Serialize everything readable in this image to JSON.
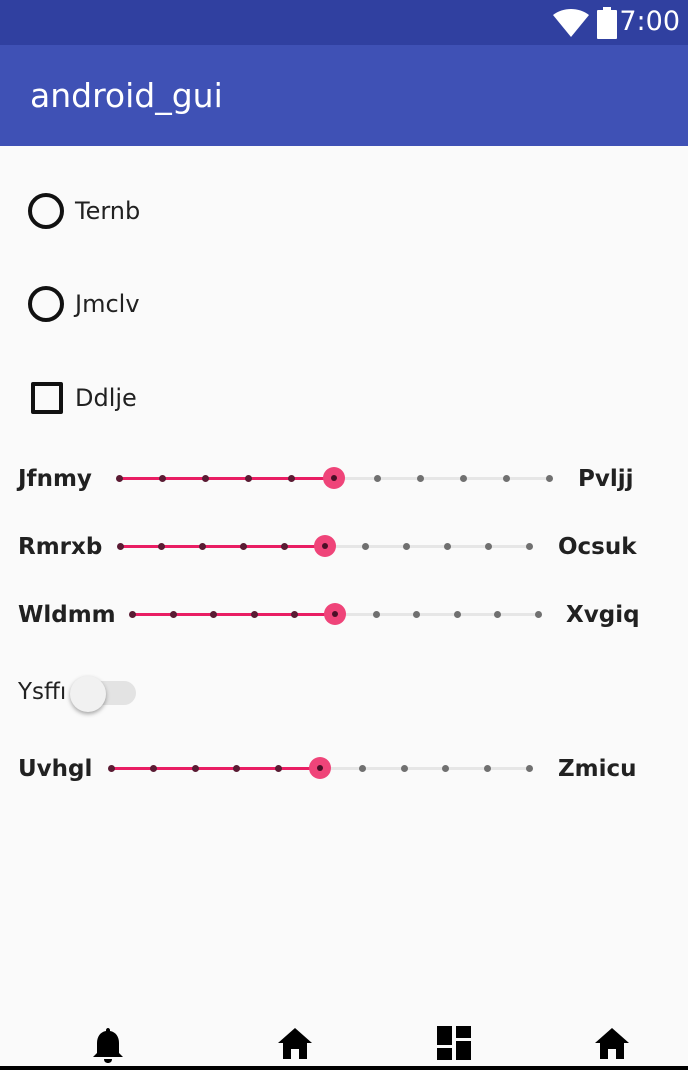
{
  "status_bar": {
    "time": "7:00",
    "icons": [
      "wifi-icon",
      "battery-icon"
    ],
    "color": "#3040a0"
  },
  "app_bar": {
    "title": "android_gui",
    "color": "#3f51b5"
  },
  "options": [
    {
      "type": "radio",
      "label": "Ternb",
      "checked": false
    },
    {
      "type": "radio",
      "label": "Jmclv",
      "checked": false
    },
    {
      "type": "checkbox",
      "label": "Ddlje",
      "checked": false
    }
  ],
  "sliders": [
    {
      "left_label": "Jfnmy",
      "right_label": "Pvljj",
      "steps": 10,
      "value": 5
    },
    {
      "left_label": "Rmrxb",
      "right_label": "Ocsuk",
      "steps": 10,
      "value": 5
    },
    {
      "left_label": "Wldmm",
      "right_label": "Xvgiq",
      "steps": 10,
      "value": 5
    }
  ],
  "switch": {
    "label": "Ysffı",
    "on": false
  },
  "slider_last": {
    "left_label": "Uvhgl",
    "right_label": "Zmicu",
    "steps": 10,
    "value": 5
  },
  "accent_color": "#e91e63",
  "bottom_nav": {
    "icons": [
      "bell-icon",
      "home-icon",
      "dashboard-icon",
      "home-icon"
    ]
  }
}
